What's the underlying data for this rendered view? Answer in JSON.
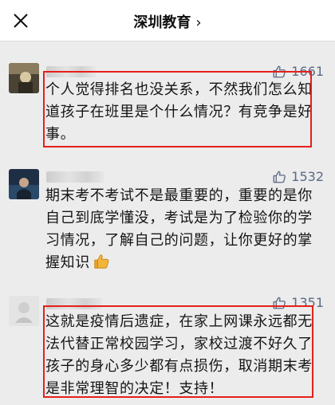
{
  "header": {
    "title": "深圳教育",
    "chevron": "›"
  },
  "comments": [
    {
      "likes": "1661",
      "text": "个人觉得排名也没关系，不然我们怎么知道孩子在班里是个什么情况？有竞争是好事。",
      "highlighted": true
    },
    {
      "likes": "1532",
      "text": "期末考不考试不是最重要的，重要的是你自己到底学懂没，考试是为了检验你的学习情况，了解自己的问题，让你更好的掌握知识",
      "emoji": "thumbs-up-emoji",
      "highlighted": false
    },
    {
      "likes": "1351",
      "text": "这就是疫情后遗症，在家上网课永远都无法代替正常校园学习，家校过渡不好久了孩子的身心多少都有点损伤，取消期末考是非常理智的决定！支持！",
      "highlighted": true
    }
  ],
  "colors": {
    "highlight_border": "#e5201b",
    "like_color": "#5b6a86",
    "background": "#ececec"
  },
  "icons": [
    "close-icon",
    "chevron-right-icon",
    "thumbs-up-icon",
    "thumbs-up-emoji"
  ]
}
